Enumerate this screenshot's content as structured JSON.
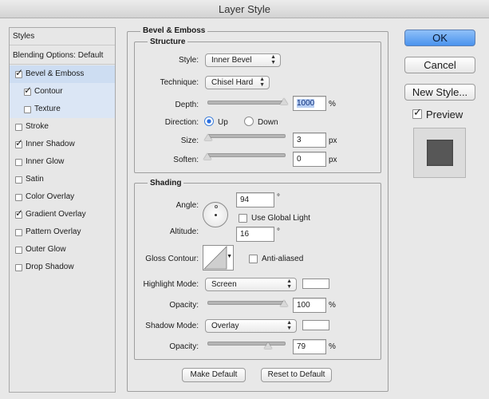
{
  "window": {
    "title": "Layer Style"
  },
  "sidebar": {
    "items": [
      {
        "label": "Styles",
        "checked": null
      },
      {
        "label": "Blending Options: Default",
        "checked": null
      },
      {
        "label": "Bevel & Emboss",
        "checked": true
      },
      {
        "label": "Contour",
        "checked": true
      },
      {
        "label": "Texture",
        "checked": false
      },
      {
        "label": "Stroke",
        "checked": false
      },
      {
        "label": "Inner Shadow",
        "checked": true
      },
      {
        "label": "Inner Glow",
        "checked": false
      },
      {
        "label": "Satin",
        "checked": false
      },
      {
        "label": "Color Overlay",
        "checked": false
      },
      {
        "label": "Gradient Overlay",
        "checked": true
      },
      {
        "label": "Pattern Overlay",
        "checked": false
      },
      {
        "label": "Outer Glow",
        "checked": false
      },
      {
        "label": "Drop Shadow",
        "checked": false
      }
    ]
  },
  "bevel": {
    "title": "Bevel & Emboss",
    "structure": {
      "title": "Structure",
      "style_label": "Style:",
      "style_value": "Inner Bevel",
      "technique_label": "Technique:",
      "technique_value": "Chisel Hard",
      "depth_label": "Depth:",
      "depth_value": "1000",
      "depth_unit": "%",
      "depth_level": 1.0,
      "direction_label": "Direction:",
      "direction_up": "Up",
      "direction_down": "Down",
      "size_label": "Size:",
      "size_value": "3",
      "size_unit": "px",
      "size_level": 0.01,
      "soften_label": "Soften:",
      "soften_value": "0",
      "soften_unit": "px",
      "soften_level": 0.0
    },
    "shading": {
      "title": "Shading",
      "angle_label": "Angle:",
      "angle_value": "94",
      "degree": "°",
      "global_light_label": "Use Global Light",
      "global_light_checked": false,
      "altitude_label": "Altitude:",
      "altitude_value": "16",
      "gloss_label": "Gloss Contour:",
      "anti_alias_label": "Anti-aliased",
      "anti_alias_checked": false,
      "highlight_label": "Highlight Mode:",
      "highlight_value": "Screen",
      "highlight_color": "#ffffff",
      "highlight_opacity_label": "Opacity:",
      "highlight_opacity_value": "100",
      "highlight_opacity_unit": "%",
      "highlight_opacity_level": 1.0,
      "shadow_label": "Shadow Mode:",
      "shadow_value": "Overlay",
      "shadow_color": "#ffffff",
      "shadow_opacity_label": "Opacity:",
      "shadow_opacity_value": "79",
      "shadow_opacity_unit": "%",
      "shadow_opacity_level": 0.79
    },
    "make_default_label": "Make Default",
    "reset_default_label": "Reset to Default"
  },
  "actions": {
    "ok_label": "OK",
    "cancel_label": "Cancel",
    "new_style_label": "New Style...",
    "preview_label": "Preview",
    "preview_checked": true
  }
}
